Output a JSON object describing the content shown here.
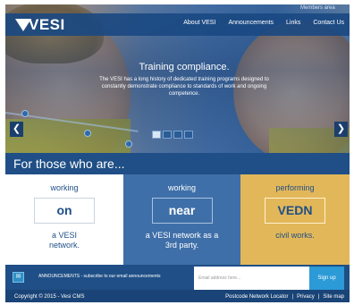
{
  "header": {
    "members_link": "Members area",
    "logo_text": "VESI",
    "nav": [
      "About VESI",
      "Announcements",
      "Links",
      "Contact Us"
    ]
  },
  "slider": {
    "title": "Training compliance.",
    "description": "The VESI has a long history of dedicated training programs designed to constantly demonstrate compliance to standards of work and ongoing competence.",
    "prev_icon": "chevron-left-icon",
    "next_icon": "chevron-right-icon",
    "prev_glyph": "❮",
    "next_glyph": "❯",
    "slide_count": 4,
    "active_slide": 1
  },
  "band": {
    "heading": "For those who are..."
  },
  "cards": [
    {
      "top": "working",
      "box": "on",
      "line1": "a VESI",
      "line2": "network."
    },
    {
      "top": "working",
      "box": "near",
      "line1": "a VESI network as a",
      "line2": "3rd party."
    },
    {
      "top": "performing",
      "box": "VEDN",
      "line1": "civil works.",
      "line2": ""
    }
  ],
  "newsletter": {
    "icon": "mail-icon",
    "icon_glyph": "✉",
    "label": "ANNOUNCEMENTS - subscribe to our email announcements",
    "email_placeholder": "Email address here...",
    "signup_label": "Sign up"
  },
  "footer": {
    "copyright": "Copyright © 2015 - Vesi CMS",
    "links": [
      "Postcode Network Locator",
      "Privacy",
      "Site map"
    ],
    "separator": "|"
  },
  "colors": {
    "brand_blue": "#1f4f86",
    "card_blue": "#3f6fa8",
    "card_gold": "#e2b75a",
    "signup_blue": "#2b9ad6"
  }
}
